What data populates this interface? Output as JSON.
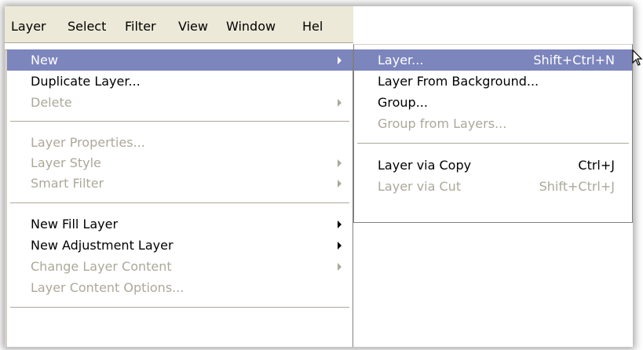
{
  "menubar": {
    "items": [
      "Layer",
      "Select",
      "Filter",
      "View",
      "Window",
      "Hel"
    ]
  },
  "layer_menu": {
    "items": [
      {
        "label": "New",
        "state": "highlighted",
        "submenu": true
      },
      {
        "label": "Duplicate Layer...",
        "state": "enabled",
        "submenu": false
      },
      {
        "label": "Delete",
        "state": "disabled",
        "submenu": true
      },
      {
        "label": "Layer Properties...",
        "state": "disabled",
        "submenu": false
      },
      {
        "label": "Layer Style",
        "state": "disabled",
        "submenu": true
      },
      {
        "label": "Smart Filter",
        "state": "disabled",
        "submenu": true
      },
      {
        "label": "New Fill Layer",
        "state": "enabled",
        "submenu": true
      },
      {
        "label": "New Adjustment Layer",
        "state": "enabled",
        "submenu": true
      },
      {
        "label": "Change Layer Content",
        "state": "disabled",
        "submenu": true
      },
      {
        "label": "Layer Content Options...",
        "state": "disabled",
        "submenu": false
      }
    ]
  },
  "new_submenu": {
    "items": [
      {
        "label": "Layer...",
        "shortcut": "Shift+Ctrl+N",
        "state": "highlighted"
      },
      {
        "label": "Layer From Background...",
        "shortcut": "",
        "state": "enabled"
      },
      {
        "label": "Group...",
        "shortcut": "",
        "state": "enabled"
      },
      {
        "label": "Group from Layers...",
        "shortcut": "",
        "state": "disabled"
      },
      {
        "label": "Layer via Copy",
        "shortcut": "Ctrl+J",
        "state": "enabled"
      },
      {
        "label": "Layer via Cut",
        "shortcut": "Shift+Ctrl+J",
        "state": "disabled"
      }
    ]
  },
  "colors": {
    "highlight": "#7d85bd",
    "disabled_text": "#aca899",
    "menubar_bg": "#ece9d8"
  }
}
